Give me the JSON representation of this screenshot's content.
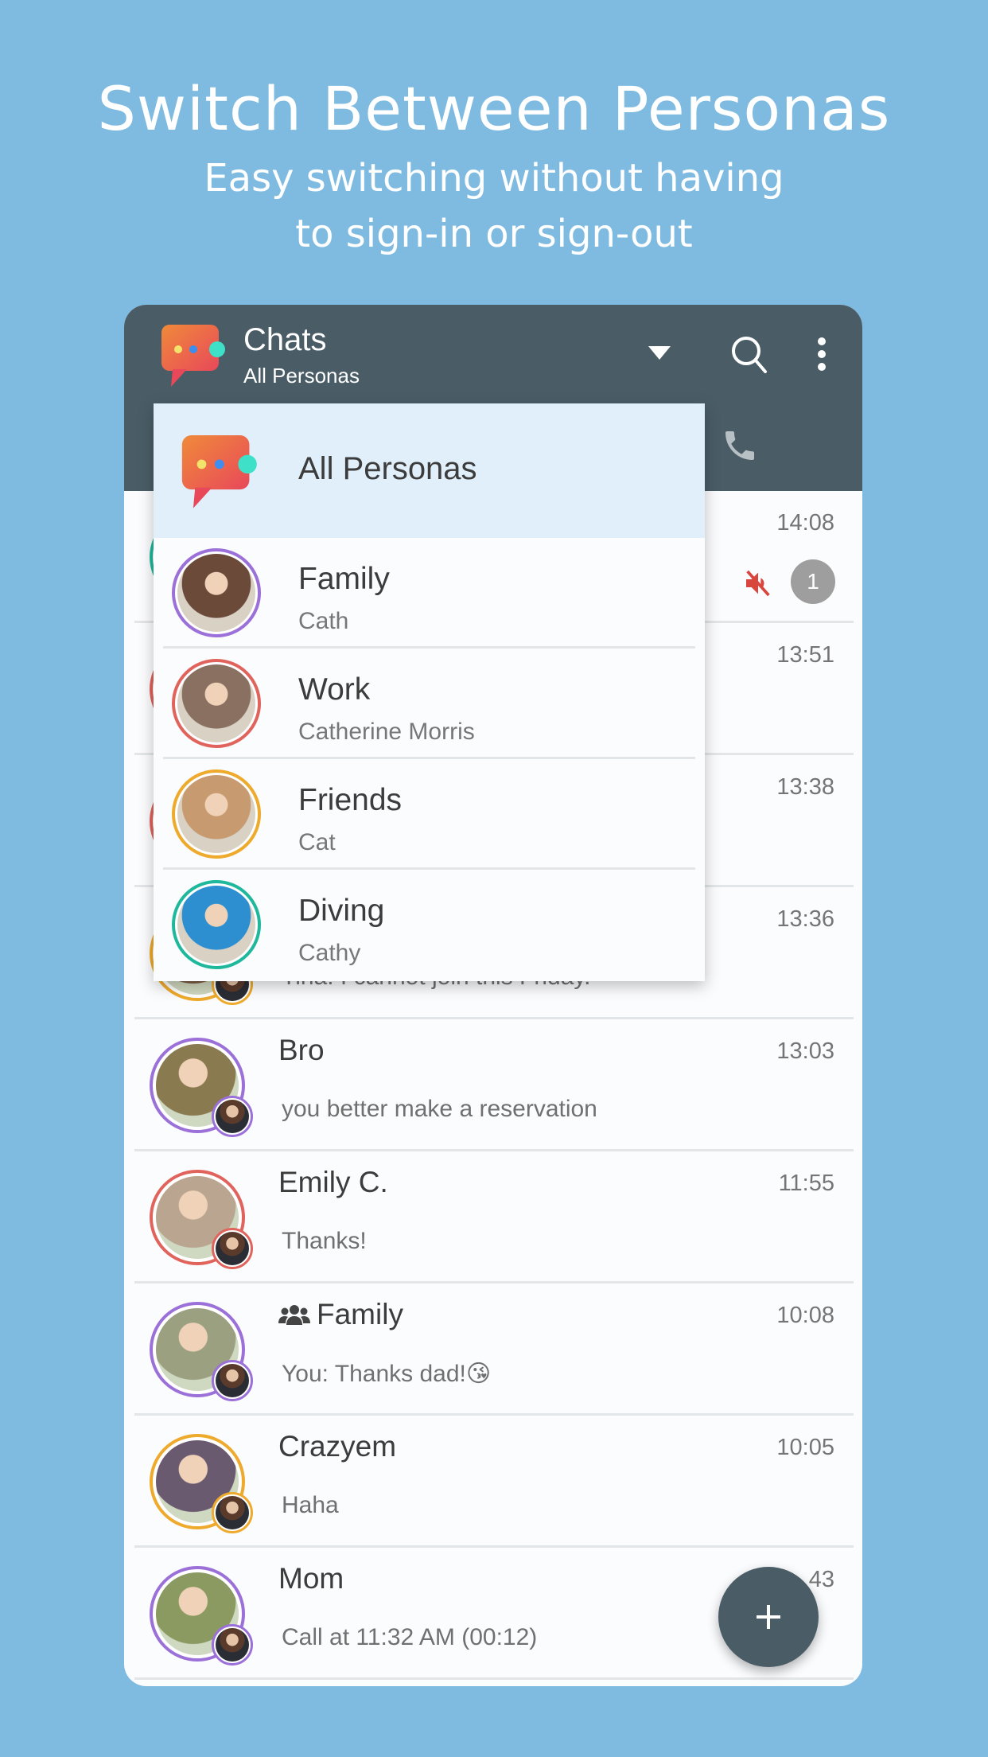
{
  "promo": {
    "title": "Switch Between Personas",
    "subtitle_line1": "Easy switching without having",
    "subtitle_line2": "to sign-in or sign-out"
  },
  "appbar": {
    "title": "Chats",
    "subtitle": "All Personas",
    "icons": [
      "app-logo-icon",
      "dropdown-arrow-icon",
      "search-icon",
      "more-vert-icon",
      "phone-icon"
    ]
  },
  "colors": {
    "header": "#4a5d66",
    "background": "#7fbbe1",
    "purple": "#9b70d8",
    "red": "#e0635c",
    "orange": "#eeaa2c",
    "teal": "#1fb89c",
    "selected": "#e0effa"
  },
  "persona_menu": {
    "all_label": "All Personas",
    "items": [
      {
        "name": "Family",
        "display_name": "Cath",
        "ring": "purple",
        "tone": "#6b4a3a"
      },
      {
        "name": "Work",
        "display_name": "Catherine Morris",
        "ring": "red",
        "tone": "#8a7060"
      },
      {
        "name": "Friends",
        "display_name": "Cat",
        "ring": "orange",
        "tone": "#c89a70"
      },
      {
        "name": "Diving",
        "display_name": "Cathy",
        "ring": "teal",
        "tone": "#2d8fd0"
      }
    ]
  },
  "chats": [
    {
      "name": "",
      "message": "",
      "time": "14:08",
      "ring": "teal",
      "muted": true,
      "unread": "1",
      "tone": "#888"
    },
    {
      "name": "",
      "message": "",
      "time": "13:51",
      "ring": "red",
      "tone": "#888"
    },
    {
      "name": "",
      "message": "",
      "time": "13:38",
      "ring": "red",
      "tone": "#888"
    },
    {
      "name": "",
      "message": "Tina: I cannot join this Friday.",
      "time": "13:36",
      "ring": "orange",
      "tone": "#7a5a40"
    },
    {
      "name": "Bro",
      "message": "you better make a reservation",
      "time": "13:03",
      "ring": "purple",
      "tone": "#8a7a50"
    },
    {
      "name": "Emily C.",
      "message": "Thanks!",
      "time": "11:55",
      "ring": "red",
      "tone": "#b9a590"
    },
    {
      "name": "Family",
      "message": "You: Thanks dad!😘",
      "time": "10:08",
      "ring": "purple",
      "group": true,
      "tone": "#9aa080"
    },
    {
      "name": "Crazyem",
      "message": "Haha",
      "time": "10:05",
      "ring": "orange",
      "tone": "#6a5a70"
    },
    {
      "name": "Mom",
      "message": "Call at 11:32 AM (00:12)",
      "time": "43",
      "ring": "purple",
      "tone": "#8a9a60"
    }
  ],
  "fab": {
    "icon": "plus-icon"
  }
}
